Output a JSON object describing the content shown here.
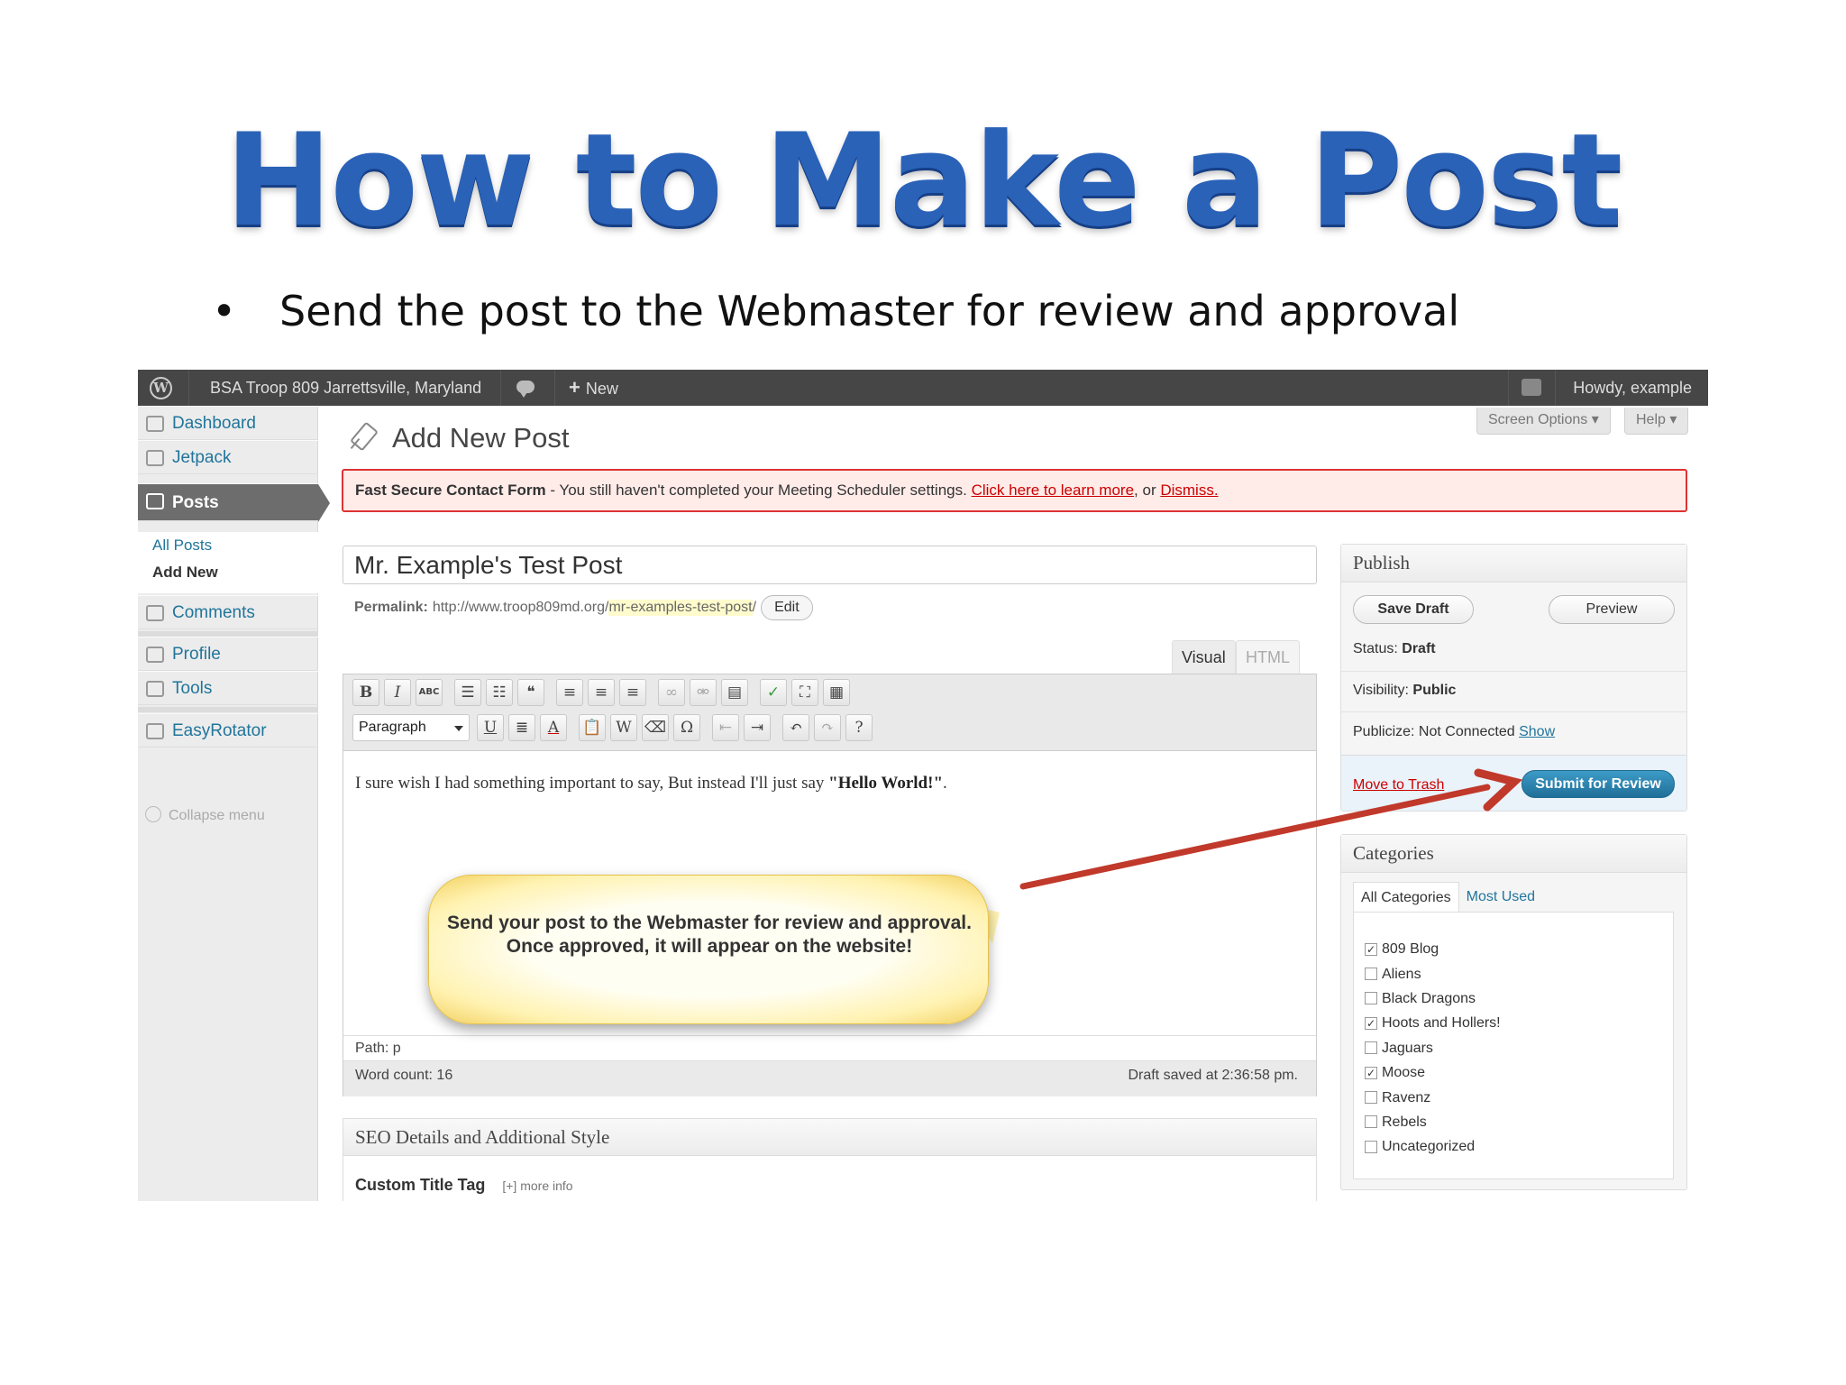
{
  "slide": {
    "title": "How to Make a Post",
    "bullet": "Send the post to the Webmaster for review and approval"
  },
  "adminbar": {
    "site_name": "BSA Troop 809 Jarrettsville, Maryland",
    "new_label": "New",
    "howdy": "Howdy, example"
  },
  "sidebar": {
    "items": [
      {
        "label": "Dashboard",
        "icon": "home-icon"
      },
      {
        "label": "Jetpack",
        "icon": "jetpack-icon"
      },
      {
        "label": "Posts",
        "icon": "pin-icon"
      },
      {
        "label": "Comments",
        "icon": "comment-icon"
      },
      {
        "label": "Profile",
        "icon": "users-icon"
      },
      {
        "label": "Tools",
        "icon": "tools-icon"
      },
      {
        "label": "EasyRotator",
        "icon": "slides-icon"
      }
    ],
    "submenu": {
      "all_posts": "All Posts",
      "add_new": "Add New"
    },
    "collapse": "Collapse menu"
  },
  "screen_options": "Screen Options",
  "help": "Help",
  "page_title": "Add New Post",
  "notice": {
    "strong": "Fast Secure Contact Form",
    "text": " - You still haven't completed your Meeting Scheduler settings. ",
    "link": "Click here to learn more",
    "or": ", or ",
    "dismiss": "Dismiss."
  },
  "post": {
    "title": "Mr. Example's Test Post",
    "permalink_label": "Permalink:",
    "permalink_base": "http://www.troop809md.org/",
    "permalink_slug": "mr-examples-test-post",
    "permalink_trail": "/",
    "edit_label": "Edit"
  },
  "editor": {
    "tab_visual": "Visual",
    "tab_html": "HTML",
    "format_select": "Paragraph",
    "content_plain": "I sure wish I had something important to say, But instead I'll just say ",
    "content_bold": "\"Hello World!\"",
    "content_end": ".",
    "path": "Path: p",
    "word_count": "Word count: 16",
    "draft_saved": "Draft saved at 2:36:58 pm."
  },
  "callout": "Send your post to the Webmaster for review and approval. Once approved, it will appear on the website!",
  "seo": {
    "heading": "SEO Details and Additional Style",
    "custom_title": "Custom Title Tag",
    "more_info": "[+] more info"
  },
  "publish": {
    "heading": "Publish",
    "save_draft": "Save Draft",
    "preview": "Preview",
    "status_label": "Status:",
    "status_value": "Draft",
    "visibility_label": "Visibility:",
    "visibility_value": "Public",
    "publicize_label": "Publicize: Not Connected",
    "publicize_link": "Show",
    "trash": "Move to Trash",
    "submit": "Submit for Review"
  },
  "categories": {
    "heading": "Categories",
    "tab_all": "All Categories",
    "tab_used": "Most Used",
    "items": [
      {
        "label": "809 Blog",
        "checked": true
      },
      {
        "label": "Aliens",
        "checked": false
      },
      {
        "label": "Black Dragons",
        "checked": false
      },
      {
        "label": "Hoots and Hollers!",
        "checked": true
      },
      {
        "label": "Jaguars",
        "checked": false
      },
      {
        "label": "Moose",
        "checked": true
      },
      {
        "label": "Ravenz",
        "checked": false
      },
      {
        "label": "Rebels",
        "checked": false
      },
      {
        "label": "Uncategorized",
        "checked": false
      }
    ]
  },
  "colors": {
    "title_blue": "#2a62b8",
    "admin_bar": "#464646",
    "submit_blue": "#1f6f98",
    "arrow_red": "#c0392b",
    "notice_border": "#dd3333"
  }
}
